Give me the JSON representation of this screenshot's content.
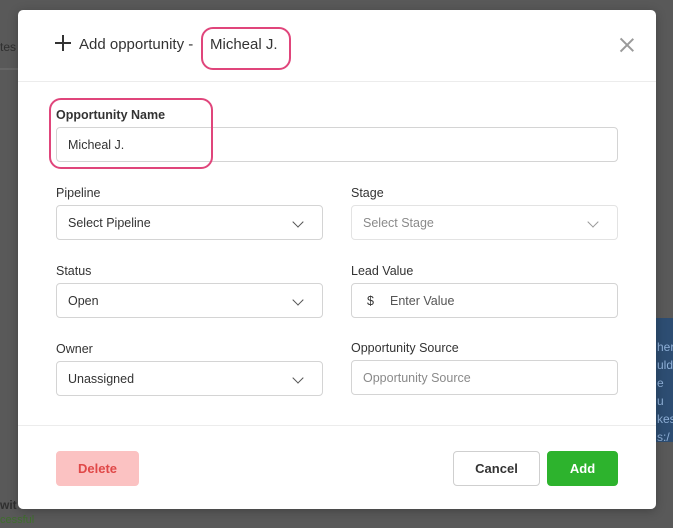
{
  "background": {
    "left_fragments": [
      "tes",
      "wit",
      "cessful"
    ],
    "right_fragments": [
      "her",
      "uld",
      "e u",
      "kes",
      "s:/"
    ],
    "bottom_fragments": [
      "..."
    ]
  },
  "modal": {
    "title": "Add opportunity -",
    "title_name": "Micheal J.",
    "close_icon": "close-icon",
    "fields": {
      "opportunity_name": {
        "label": "Opportunity Name",
        "value": "Micheal J."
      },
      "pipeline": {
        "label": "Pipeline",
        "value": "Select Pipeline"
      },
      "stage": {
        "label": "Stage",
        "placeholder": "Select Stage"
      },
      "status": {
        "label": "Status",
        "value": "Open"
      },
      "lead_value": {
        "label": "Lead Value",
        "currency": "$",
        "placeholder": "Enter Value"
      },
      "owner": {
        "label": "Owner",
        "value": "Unassigned"
      },
      "opportunity_source": {
        "label": "Opportunity Source",
        "placeholder": "Opportunity Source"
      }
    },
    "buttons": {
      "delete": "Delete",
      "cancel": "Cancel",
      "add": "Add"
    },
    "colors": {
      "highlight": "#e0457b",
      "delete_bg": "#fbc2c2",
      "delete_text": "#e04848",
      "add_bg": "#2db32d"
    }
  }
}
